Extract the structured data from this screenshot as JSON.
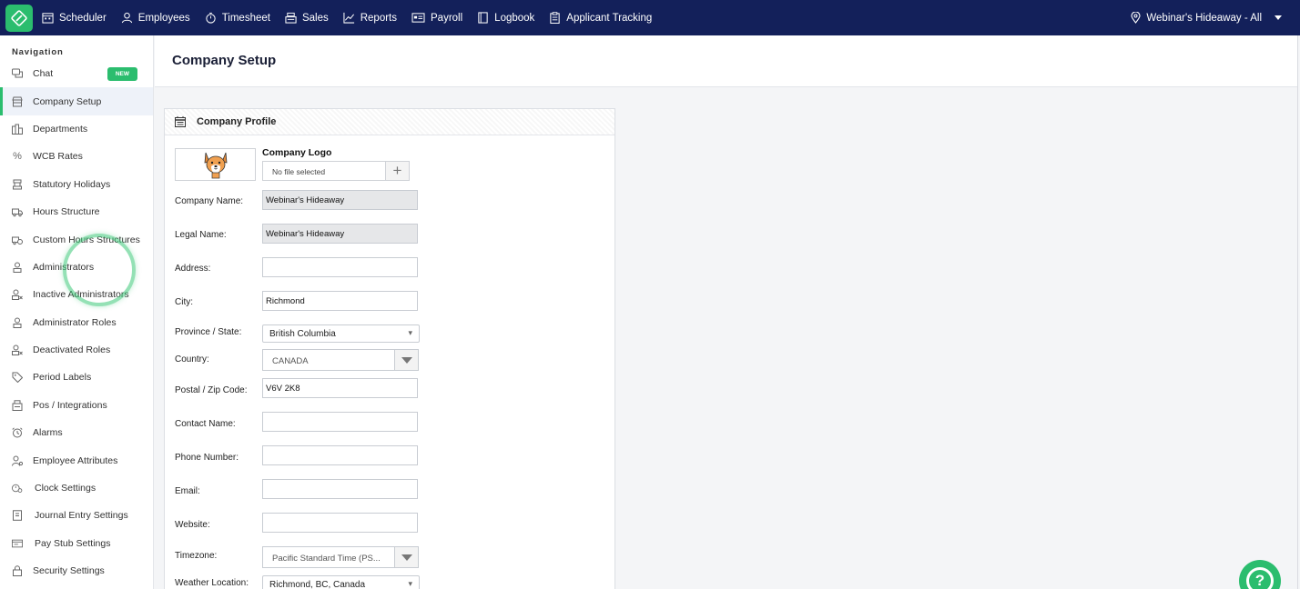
{
  "topnav": {
    "items": [
      {
        "label": "Scheduler",
        "icon": "calendar-icon"
      },
      {
        "label": "Employees",
        "icon": "person-icon"
      },
      {
        "label": "Timesheet",
        "icon": "stopwatch-icon"
      },
      {
        "label": "Sales",
        "icon": "register-icon"
      },
      {
        "label": "Reports",
        "icon": "line-chart-icon"
      },
      {
        "label": "Payroll",
        "icon": "payroll-icon"
      },
      {
        "label": "Logbook",
        "icon": "book-icon"
      },
      {
        "label": "Applicant Tracking",
        "icon": "clipboard-icon"
      }
    ],
    "location": "Webinar's Hideaway - All"
  },
  "sidebar": {
    "heading": "Navigation",
    "new_badge": "NEW",
    "items": [
      {
        "label": "Chat"
      },
      {
        "label": "Company Setup"
      },
      {
        "label": "Departments"
      },
      {
        "label": "WCB Rates"
      },
      {
        "label": "Statutory Holidays"
      },
      {
        "label": "Hours Structure"
      },
      {
        "label": "Custom Hours Structures"
      },
      {
        "label": "Administrators"
      },
      {
        "label": "Inactive Administrators"
      },
      {
        "label": "Administrator Roles"
      },
      {
        "label": "Deactivated Roles"
      },
      {
        "label": "Period Labels"
      },
      {
        "label": "Pos / Integrations"
      },
      {
        "label": "Alarms"
      },
      {
        "label": "Employee Attributes"
      },
      {
        "label": "Clock Settings"
      },
      {
        "label": "Journal Entry Settings"
      },
      {
        "label": "Pay Stub Settings"
      },
      {
        "label": "Security Settings"
      }
    ]
  },
  "page": {
    "title": "Company Setup"
  },
  "profile": {
    "title": "Company Profile",
    "logo_label": "Company Logo",
    "file_placeholder": "No file selected",
    "fields": {
      "company_name": {
        "label": "Company Name:",
        "value": "Webinar's Hideaway"
      },
      "legal_name": {
        "label": "Legal Name:",
        "value": "Webinar's Hideaway"
      },
      "address": {
        "label": "Address:",
        "value": ""
      },
      "city": {
        "label": "City:",
        "value": "Richmond"
      },
      "province": {
        "label": "Province / State:",
        "value": "British Columbia"
      },
      "country": {
        "label": "Country:",
        "value": "CANADA"
      },
      "postal": {
        "label": "Postal / Zip Code:",
        "value": "V6V 2K8"
      },
      "contact": {
        "label": "Contact Name:",
        "value": ""
      },
      "phone": {
        "label": "Phone Number:",
        "value": ""
      },
      "email": {
        "label": "Email:",
        "value": ""
      },
      "website": {
        "label": "Website:",
        "value": ""
      },
      "timezone": {
        "label": "Timezone:",
        "value": "Pacific Standard Time (PS..."
      },
      "weather": {
        "label": "Weather Location:",
        "value": "Richmond, BC, Canada"
      }
    }
  },
  "colors": {
    "nav_bg": "#13205a",
    "accent": "#2bbd6e"
  }
}
